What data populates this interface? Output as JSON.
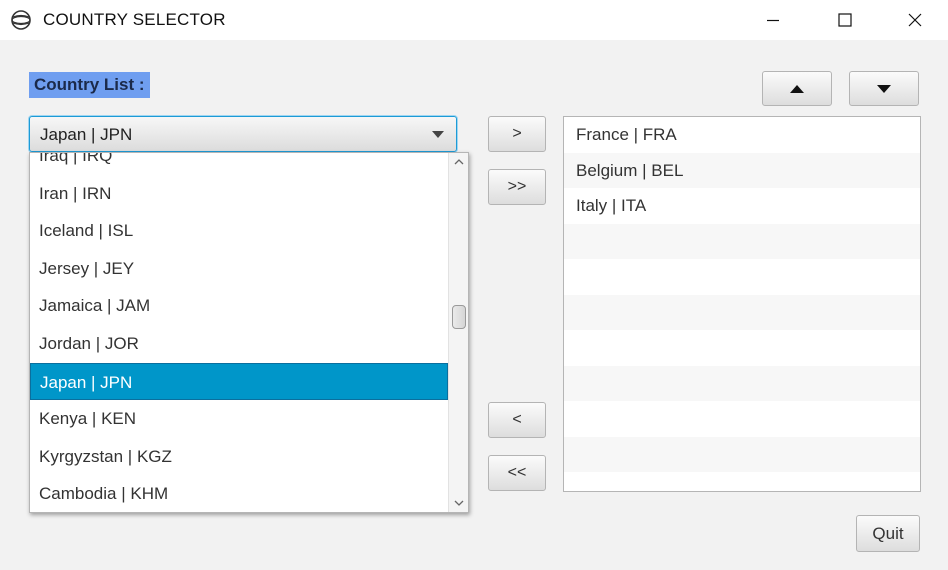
{
  "window": {
    "title": "COUNTRY SELECTOR",
    "app_icon": "globe-icon",
    "controls": [
      "minimize-icon",
      "maximize-icon",
      "close-icon"
    ]
  },
  "country_list": {
    "label": "Country List :",
    "selected_value": "Japan | JPN",
    "partial_top_item": "Iraq | IRQ",
    "items": [
      {
        "label": "Iran | IRN",
        "selected": false
      },
      {
        "label": "Iceland | ISL",
        "selected": false
      },
      {
        "label": "Jersey | JEY",
        "selected": false
      },
      {
        "label": "Jamaica | JAM",
        "selected": false
      },
      {
        "label": "Jordan | JOR",
        "selected": false
      },
      {
        "label": "Japan | JPN",
        "selected": true
      },
      {
        "label": "Kenya | KEN",
        "selected": false
      },
      {
        "label": "Kyrgyzstan | KGZ",
        "selected": false
      },
      {
        "label": "Cambodia | KHM",
        "selected": false
      }
    ]
  },
  "transfer_buttons": {
    "add": ">",
    "add_all": ">>",
    "remove": "<",
    "remove_all": "<<"
  },
  "order_buttons": {
    "up_icon": "triangle-up-icon",
    "down_icon": "triangle-down-icon"
  },
  "selected_countries": [
    "France | FRA",
    "Belgium | BEL",
    "Italy | ITA",
    "",
    "",
    "",
    "",
    "",
    "",
    "",
    ""
  ],
  "footer": {
    "quit_label": "Quit"
  },
  "colors": {
    "label_bg": "#6f9ef0",
    "selection_bg": "#0096c9",
    "focus_border": "#1d9bd6",
    "window_bg": "#f2f2f2"
  }
}
